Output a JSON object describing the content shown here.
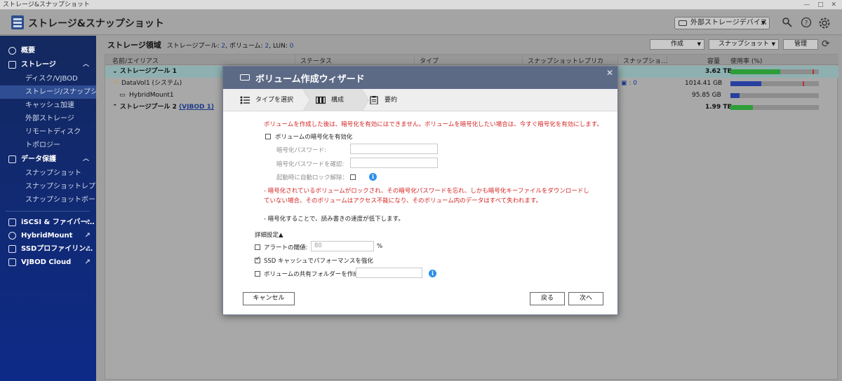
{
  "window": {
    "title": "ストレージ&スナップショット",
    "controls": "— □ ✕"
  },
  "header": {
    "app_title": "ストレージ&スナップショット",
    "external_device_label": "外部ストレージデバイス"
  },
  "sidebar": {
    "overview": "概要",
    "storage": "ストレージ",
    "storage_items": [
      "ディスク/VJBOD",
      "ストレージ/スナップショ…",
      "キャッシュ加速",
      "外部ストレージ",
      "リモートディスク",
      "トポロジー"
    ],
    "data_protection": "データ保護",
    "protection_items": [
      "スナップショット",
      "スナップショットレプリカ",
      "スナップショットボールト"
    ],
    "bottom_items": [
      "iSCSI & ファイバー…",
      "HybridMount",
      "SSDプロファイリン…",
      "VJBOD Cloud"
    ]
  },
  "main": {
    "title": "ストレージ領域",
    "stats": {
      "pool_label": "ストレージプール:",
      "pool_count": "2",
      "volume_label": "ボリューム:",
      "volume_count": "2",
      "lun_label": "LUN:",
      "lun_count": "0"
    },
    "buttons": {
      "create": "作成",
      "snapshot": "スナップショット",
      "manage": "管理"
    },
    "columns": [
      "名前/エイリアス",
      "ステータス",
      "タイプ",
      "スナップショットレプリカ",
      "スナップショ…",
      "容量",
      "使用率 (%)"
    ],
    "rows": [
      {
        "name": "ストレージプール 1",
        "capacity": "3.62 TB",
        "usage": 0.56
      },
      {
        "name": "DataVol1 (システム)",
        "snapshot": "0",
        "capacity": "1014.41 GB",
        "usage": 0.35
      },
      {
        "name": "HybridMount1",
        "capacity": "95.85 GB",
        "usage": 0.1
      },
      {
        "name": "ストレージプール 2",
        "link": "(VJBOD 1)",
        "capacity": "1.99 TB",
        "usage": 0.25
      }
    ]
  },
  "wizard": {
    "title": "ボリューム作成ウィザード",
    "steps": [
      "タイプを選択",
      "構成",
      "要約"
    ],
    "warning_top": "ボリュームを作成した後は、暗号化を有効にはできません。ボリュームを暗号化したい場合は、今すぐ暗号化を有効にします。",
    "enable_encryption": "ボリュームの暗号化を有効化",
    "password_label": "暗号化パスワード:",
    "confirm_password_label": "暗号化パスワードを確認:",
    "auto_unlock_label": "起動時に自動ロック解除：",
    "warning_line1": "- 暗号化されているボリュームがロックされ、その暗号化パスワードを忘れ、しかも暗号化キーファイルをダウンロードし",
    "warning_line2": "ていない場合、そのボリュームはアクセス不能になり、そのボリューム内のデータはすべて失われます。",
    "note_speed": "- 暗号化することで、読み書きの速度が低下します。",
    "advanced_label": "詳細設定▲",
    "alert_threshold_label": "アラートの閾値:",
    "alert_threshold_value": "80",
    "alert_unit": "%",
    "ssd_cache_label": "SSD キャッシュでパフォーマンスを強化",
    "shared_folder_label": "ボリュームの共有フォルダーを作成",
    "buttons": {
      "cancel": "キャンセル",
      "back": "戻る",
      "next": "次へ"
    }
  }
}
